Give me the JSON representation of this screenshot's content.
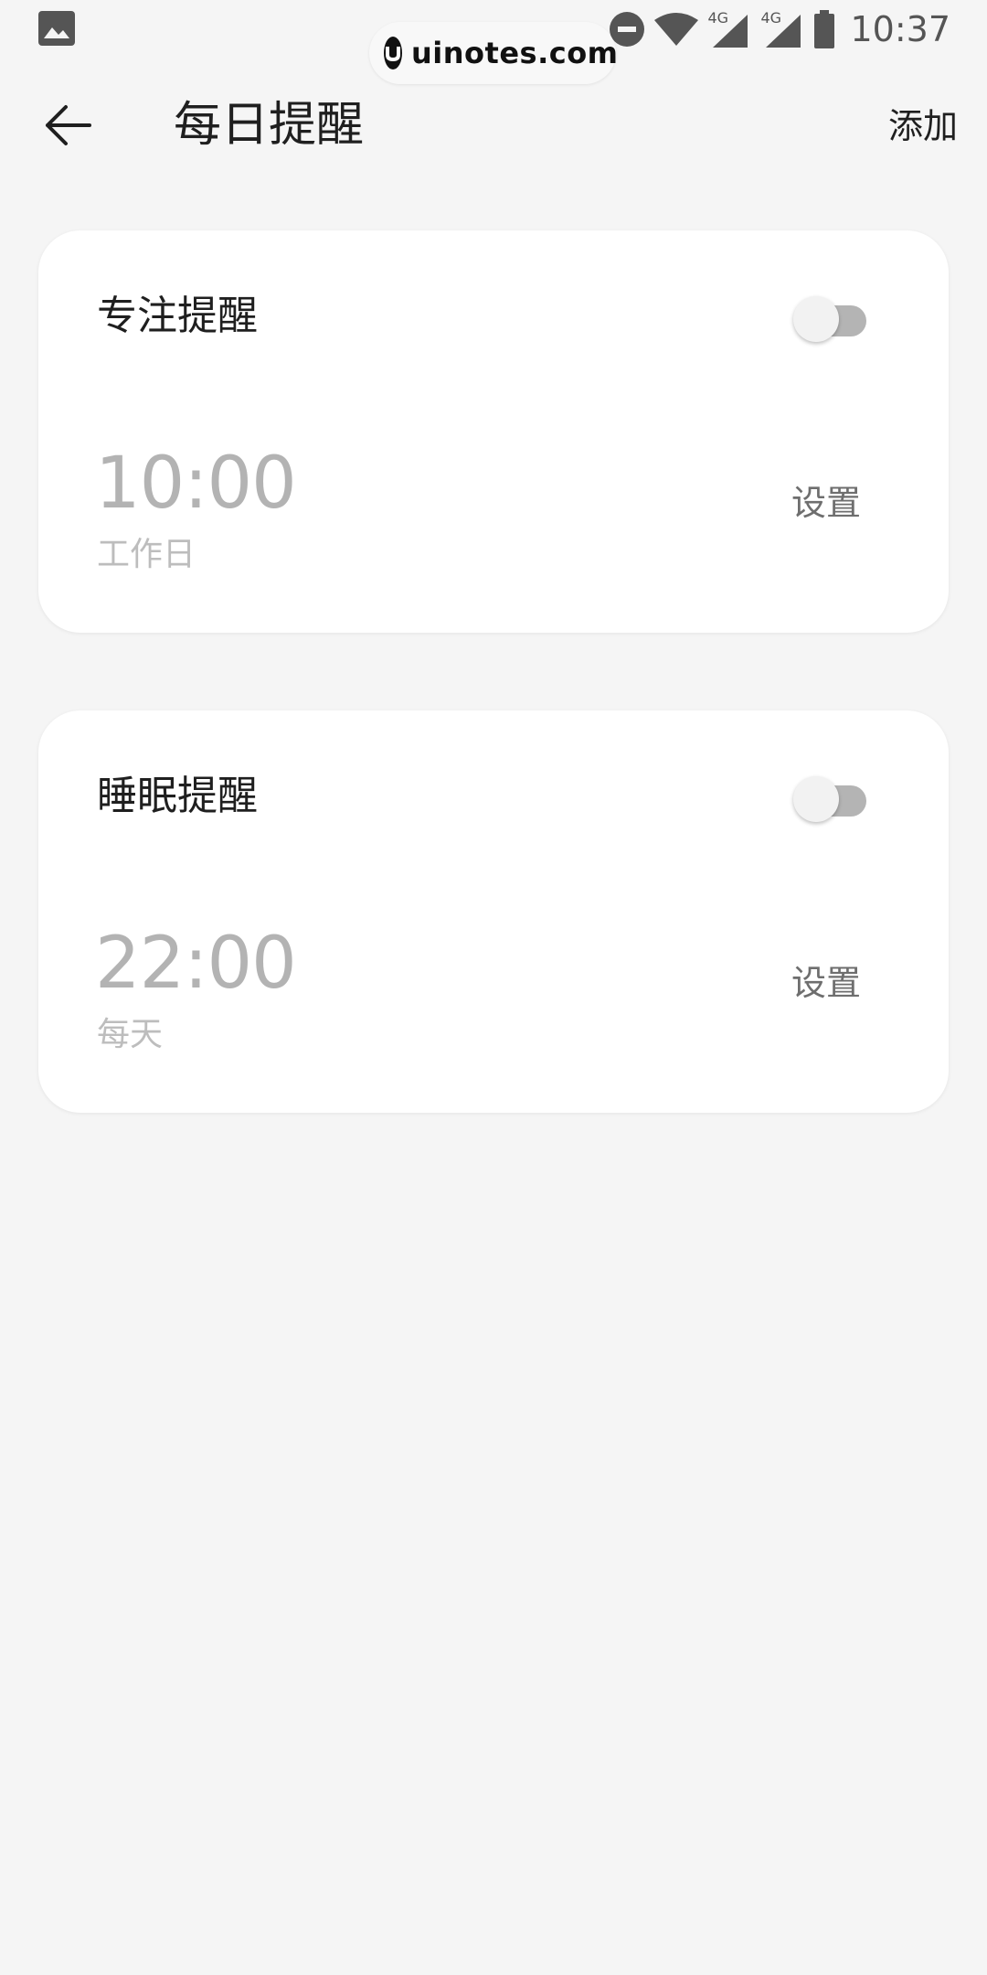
{
  "status_bar": {
    "time": "10:37",
    "network_1": "4G",
    "network_2": "4G",
    "icons": [
      "gallery-icon",
      "do-not-disturb-icon",
      "wifi-icon",
      "signal-icon",
      "signal-icon",
      "battery-icon"
    ]
  },
  "watermark": {
    "text": "uinotes.com"
  },
  "header": {
    "title": "每日提醒",
    "add_label": "添加",
    "back_icon": "back-arrow-icon"
  },
  "reminders": [
    {
      "title": "专注提醒",
      "time": "10:00",
      "repeat": "工作日",
      "setting_label": "设置",
      "enabled": false
    },
    {
      "title": "睡眠提醒",
      "time": "22:00",
      "repeat": "每天",
      "setting_label": "设置",
      "enabled": false
    }
  ],
  "colors": {
    "background": "#f5f5f5",
    "card": "#ffffff",
    "primary_text": "#1f1f1f",
    "muted_text": "#b3b3b3",
    "toggle_off_track": "#b4b4b4"
  }
}
